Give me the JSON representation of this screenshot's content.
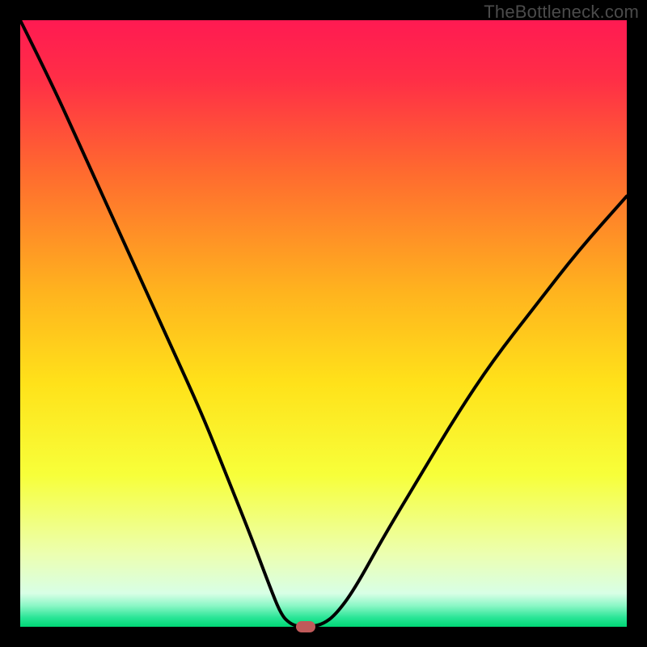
{
  "watermark": "TheBottleneck.com",
  "colors": {
    "frame_bg": "#000000",
    "marker": "#c05a5a",
    "curve": "#000000"
  },
  "gradient_stops": [
    {
      "offset": 0.0,
      "color": "#ff1a52"
    },
    {
      "offset": 0.1,
      "color": "#ff2f46"
    },
    {
      "offset": 0.25,
      "color": "#ff6a2f"
    },
    {
      "offset": 0.45,
      "color": "#ffb41e"
    },
    {
      "offset": 0.6,
      "color": "#ffe21a"
    },
    {
      "offset": 0.75,
      "color": "#f7ff3a"
    },
    {
      "offset": 0.88,
      "color": "#ecffb0"
    },
    {
      "offset": 0.945,
      "color": "#d8ffe6"
    },
    {
      "offset": 0.965,
      "color": "#8cf7c6"
    },
    {
      "offset": 0.985,
      "color": "#29e596"
    },
    {
      "offset": 1.0,
      "color": "#00d775"
    }
  ],
  "chart_data": {
    "type": "line",
    "title": "",
    "xlabel": "",
    "ylabel": "",
    "xlim": [
      0,
      100
    ],
    "ylim": [
      0,
      100
    ],
    "series": [
      {
        "name": "bottleneck-curve",
        "x": [
          0,
          5,
          10,
          15,
          20,
          25,
          30,
          34,
          38,
          41,
          43,
          44.5,
          46,
          48,
          50,
          52,
          55,
          60,
          66,
          72,
          78,
          85,
          92,
          100
        ],
        "values": [
          100,
          90,
          79,
          68,
          57,
          46,
          35,
          25,
          15,
          7,
          2,
          0.5,
          0,
          0,
          0.5,
          2,
          6,
          15,
          25,
          35,
          44,
          53,
          62,
          71
        ]
      }
    ],
    "marker": {
      "x": 47,
      "y": 0
    }
  }
}
